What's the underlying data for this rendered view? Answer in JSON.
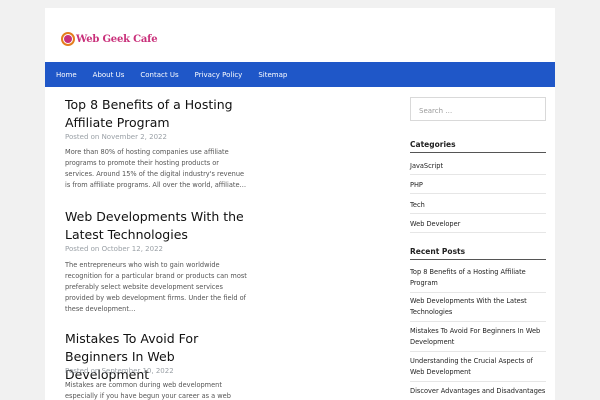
{
  "site": {
    "logo_text": "Web Geek Cafe"
  },
  "nav": {
    "items": [
      {
        "label": "Home"
      },
      {
        "label": "About Us"
      },
      {
        "label": "Contact Us"
      },
      {
        "label": "Privacy Policy"
      },
      {
        "label": "Sitemap"
      }
    ]
  },
  "posts": [
    {
      "title": "Top 8 Benefits of a Hosting Affiliate Program",
      "date": "Posted on November 2, 2022",
      "excerpt": "More than 80% of hosting companies use affiliate programs to promote their hosting products or services. Around 15% of the digital industry's revenue is from affiliate programs. All over the world, affiliate…"
    },
    {
      "title": "Web Developments With the Latest Technologies",
      "date": "Posted on October 12, 2022",
      "excerpt": "The entrepreneurs who wish to gain worldwide recognition for a particular brand or products can most preferably select website development services provided by web development firms. Under the field of these development…"
    },
    {
      "title": "Mistakes To Avoid For Beginners In Web Development",
      "date": "Posted on September 10, 2022",
      "excerpt": "Mistakes are common during web development especially if you have begun your career as a web"
    }
  ],
  "sidebar": {
    "search_placeholder": "Search …",
    "categories_title": "Categories",
    "categories": [
      "JavaScript",
      "PHP",
      "Tech",
      "Web Developer"
    ],
    "recent_title": "Recent Posts",
    "recent_posts": [
      "Top 8 Benefits of a Hosting Affiliate Program",
      "Web Developments With the Latest Technologies",
      "Mistakes To Avoid For Beginners In Web Development",
      "Understanding the Crucial Aspects of Web Development",
      "Discover Advantages and Disadvantages"
    ]
  }
}
